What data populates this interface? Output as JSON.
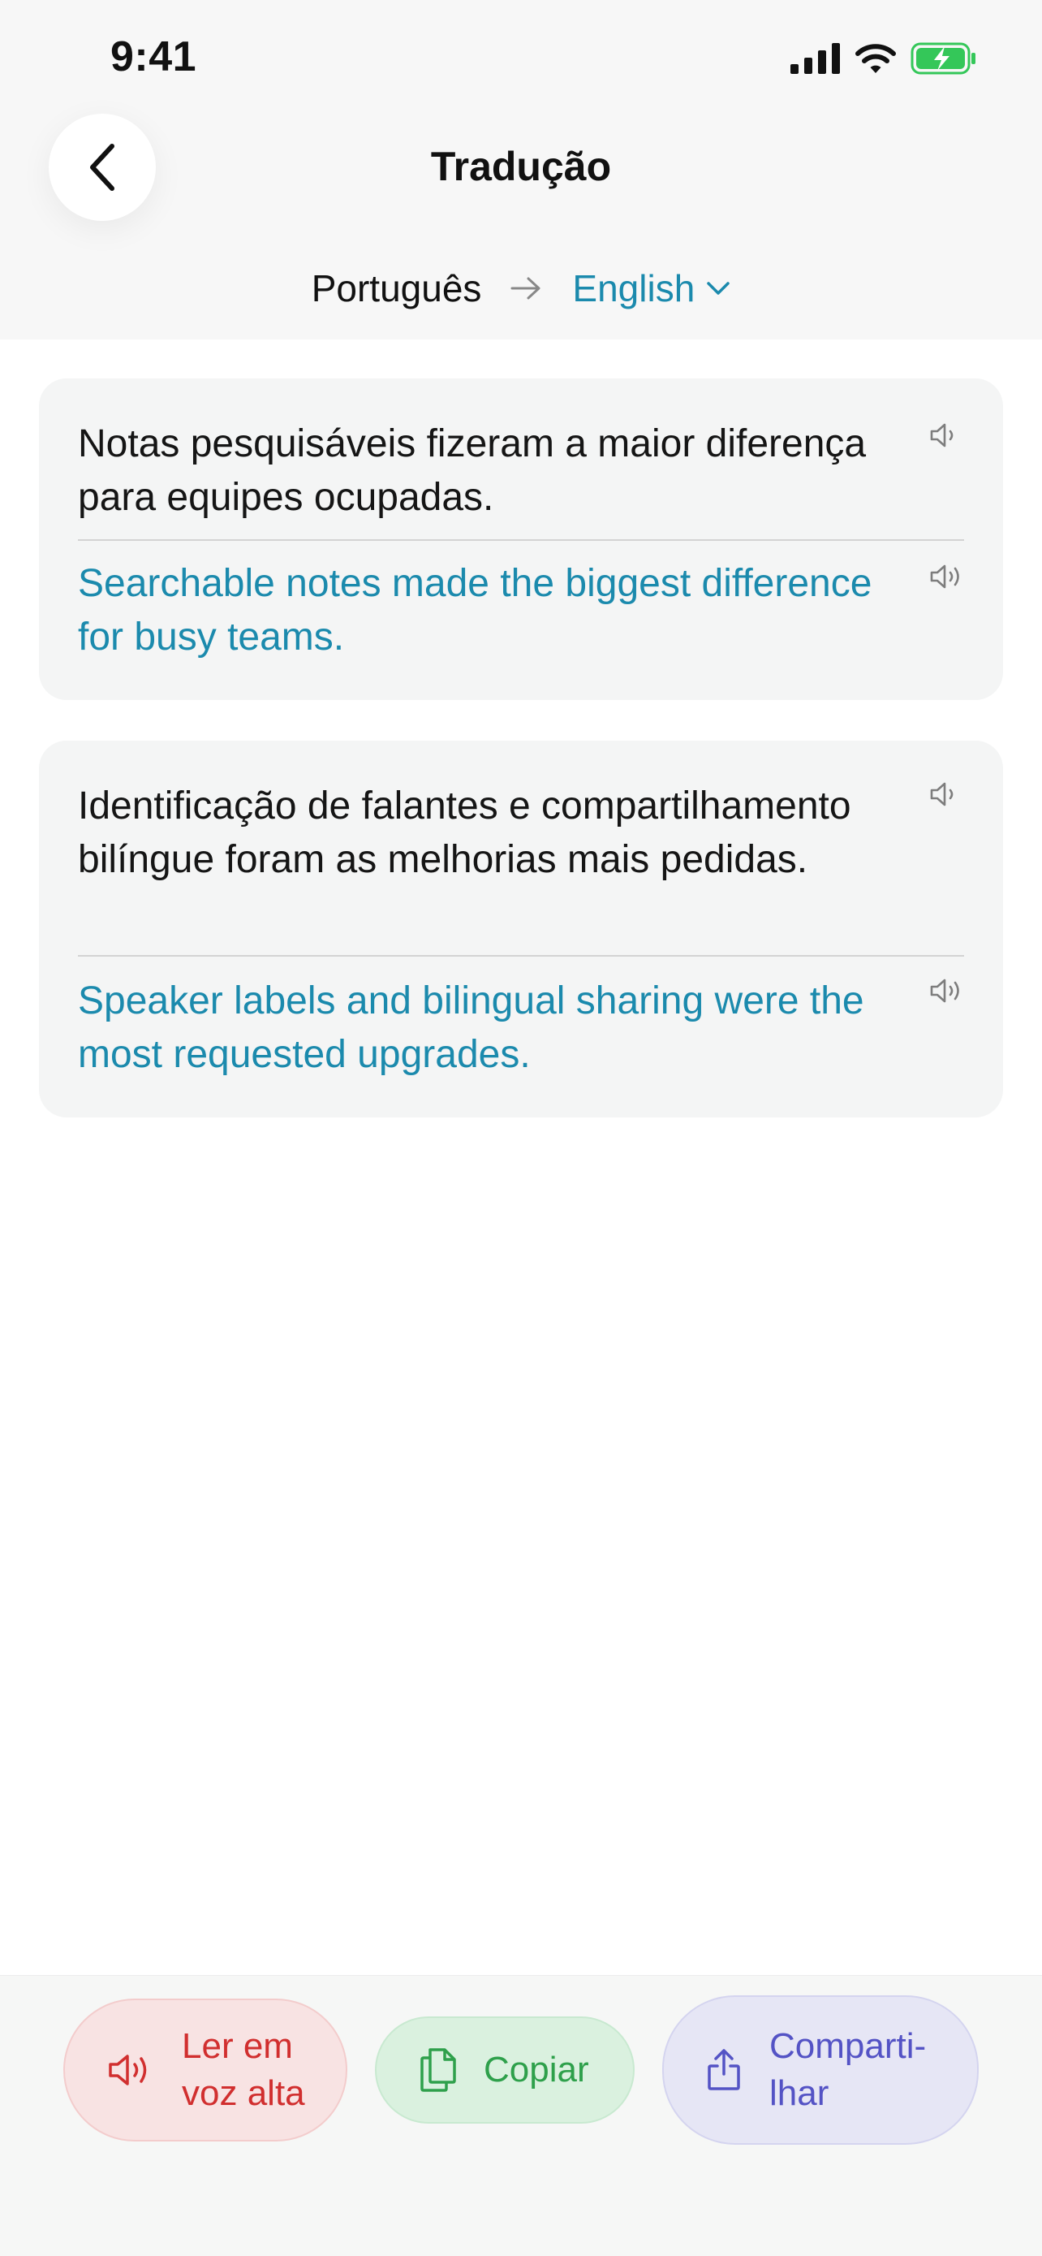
{
  "status_bar": {
    "time": "9:41"
  },
  "header": {
    "title": "Tradução",
    "source_language": "Português",
    "target_language": "English"
  },
  "cards": [
    {
      "source": "Notas pesquisáveis fizeram a maior diferença para equipes ocupadas.",
      "translation": "Searchable notes made the biggest difference for busy teams."
    },
    {
      "source": "Identificação de falantes e compartilhamento bilíngue foram as melhorias mais pedidas.",
      "translation": "Speaker labels and bilingual sharing were the most requested upgrades."
    }
  ],
  "actions": {
    "read_aloud_line1": "Ler em",
    "read_aloud_line2": "voz alta",
    "copy": "Copiar",
    "share_line1": "Comparti-",
    "share_line2": "lhar"
  },
  "colors": {
    "accent": "#1b8aad",
    "read_aloud": "#d12f2f",
    "copy": "#2ea04b",
    "share": "#5453c5",
    "battery": "#34c759"
  },
  "icons": {
    "back": "chevron-left-icon",
    "speaker": "speaker-icon",
    "copy": "copy-icon",
    "share": "share-icon"
  }
}
